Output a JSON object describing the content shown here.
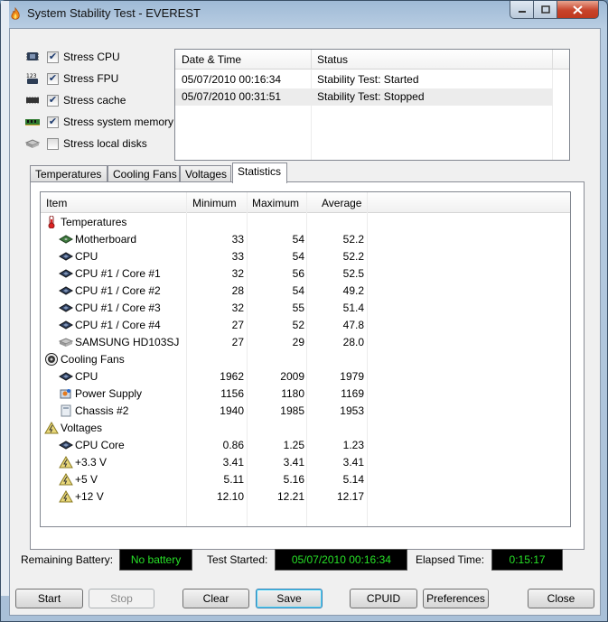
{
  "window": {
    "title": "System Stability Test - EVEREST"
  },
  "stress_options": [
    {
      "label": "Stress CPU",
      "checked": true,
      "icon": "cpu-chip-icon"
    },
    {
      "label": "Stress FPU",
      "checked": true,
      "icon": "fpu-chip-icon"
    },
    {
      "label": "Stress cache",
      "checked": true,
      "icon": "cache-chip-icon"
    },
    {
      "label": "Stress system memory",
      "checked": true,
      "icon": "memory-module-icon"
    },
    {
      "label": "Stress local disks",
      "checked": false,
      "icon": "hard-disk-icon"
    }
  ],
  "log": {
    "columns": [
      "Date & Time",
      "Status"
    ],
    "rows": [
      [
        "05/07/2010 00:16:34",
        "Stability Test: Started"
      ],
      [
        "05/07/2010 00:31:51",
        "Stability Test: Stopped"
      ]
    ]
  },
  "tabs": [
    "Temperatures",
    "Cooling Fans",
    "Voltages",
    "Statistics"
  ],
  "active_tab": "Statistics",
  "stats": {
    "columns": [
      "Item",
      "Minimum",
      "Maximum",
      "Average"
    ],
    "rows": [
      {
        "type": "group",
        "label": "Temperatures",
        "icon": "thermometer-icon"
      },
      {
        "type": "item",
        "label": "Motherboard",
        "icon": "motherboard-icon",
        "min": "33",
        "max": "54",
        "avg": "52.2"
      },
      {
        "type": "item",
        "label": "CPU",
        "icon": "cpu-icon",
        "min": "33",
        "max": "54",
        "avg": "52.2"
      },
      {
        "type": "item",
        "label": "CPU #1 / Core #1",
        "icon": "cpu-icon",
        "min": "32",
        "max": "56",
        "avg": "52.5"
      },
      {
        "type": "item",
        "label": "CPU #1 / Core #2",
        "icon": "cpu-icon",
        "min": "28",
        "max": "54",
        "avg": "49.2"
      },
      {
        "type": "item",
        "label": "CPU #1 / Core #3",
        "icon": "cpu-icon",
        "min": "32",
        "max": "55",
        "avg": "51.4"
      },
      {
        "type": "item",
        "label": "CPU #1 / Core #4",
        "icon": "cpu-icon",
        "min": "27",
        "max": "52",
        "avg": "47.8"
      },
      {
        "type": "item",
        "label": "SAMSUNG HD103SJ",
        "icon": "hard-disk-icon",
        "min": "27",
        "max": "29",
        "avg": "28.0"
      },
      {
        "type": "group",
        "label": "Cooling Fans",
        "icon": "fan-icon"
      },
      {
        "type": "item",
        "label": "CPU",
        "icon": "cpu-icon",
        "min": "1962",
        "max": "2009",
        "avg": "1979"
      },
      {
        "type": "item",
        "label": "Power Supply",
        "icon": "power-supply-icon",
        "min": "1156",
        "max": "1180",
        "avg": "1169"
      },
      {
        "type": "item",
        "label": "Chassis #2",
        "icon": "chassis-icon",
        "min": "1940",
        "max": "1985",
        "avg": "1953"
      },
      {
        "type": "group",
        "label": "Voltages",
        "icon": "voltage-icon"
      },
      {
        "type": "item",
        "label": "CPU Core",
        "icon": "cpu-icon",
        "min": "0.86",
        "max": "1.25",
        "avg": "1.23"
      },
      {
        "type": "item",
        "label": "+3.3 V",
        "icon": "voltage-icon",
        "min": "3.41",
        "max": "3.41",
        "avg": "3.41"
      },
      {
        "type": "item",
        "label": "+5 V",
        "icon": "voltage-icon",
        "min": "5.11",
        "max": "5.16",
        "avg": "5.14"
      },
      {
        "type": "item",
        "label": "+12 V",
        "icon": "voltage-icon",
        "min": "12.10",
        "max": "12.21",
        "avg": "12.17"
      }
    ]
  },
  "status": {
    "battery_label": "Remaining Battery:",
    "battery_value": "No battery",
    "started_label": "Test Started:",
    "started_value": "05/07/2010 00:16:34",
    "elapsed_label": "Elapsed Time:",
    "elapsed_value": "0:15:17"
  },
  "buttons": {
    "start": "Start",
    "stop": "Stop",
    "clear": "Clear",
    "save": "Save",
    "cpuid": "CPUID",
    "preferences": "Preferences",
    "close": "Close"
  },
  "colors": {
    "lcd_text": "#27e027",
    "lcd_bg": "#000000",
    "close_button": "#c7432a"
  }
}
